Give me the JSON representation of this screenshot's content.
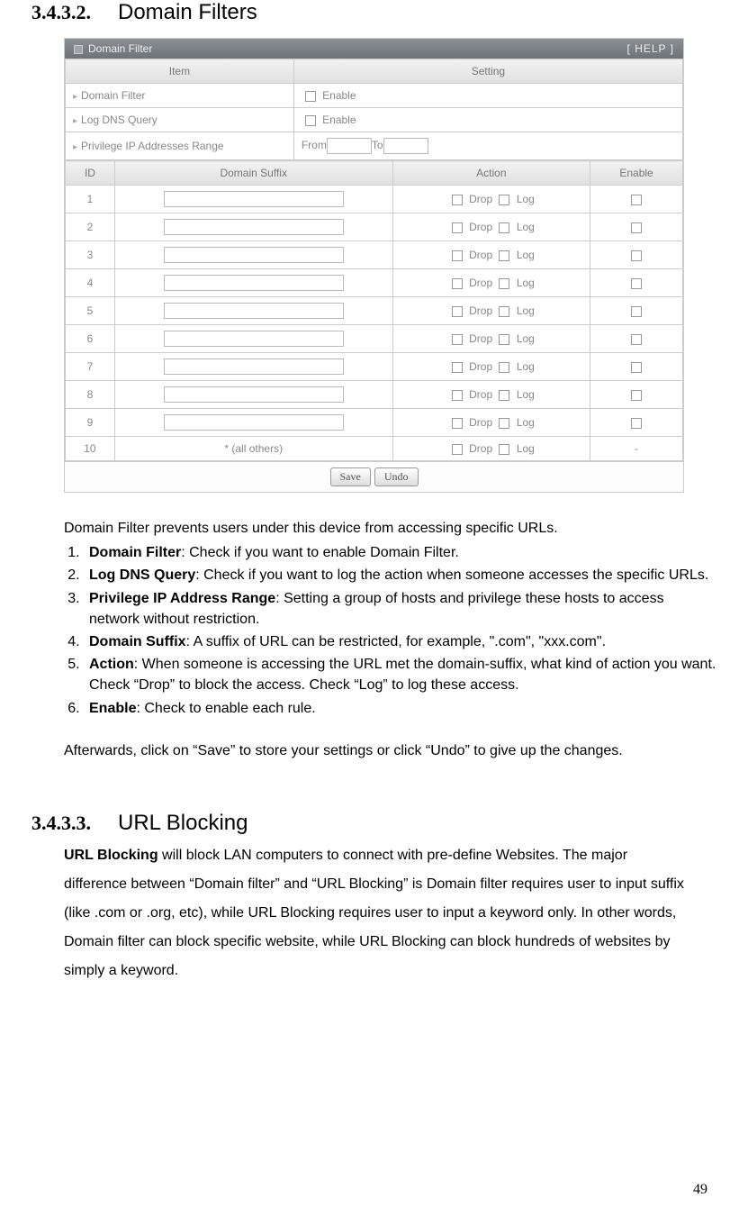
{
  "section1": {
    "num": "3.4.3.2.",
    "title": "Domain Filters"
  },
  "figure": {
    "title_prefix": "Domain Filter",
    "help": "[ HELP ]",
    "head_item": "Item",
    "head_setting": "Setting",
    "row1_label": "Domain Filter",
    "row2_label": "Log DNS Query",
    "row3_label": "Privilege IP Addresses Range",
    "enable_label": "Enable",
    "from": "From",
    "to": "To",
    "col_id": "ID",
    "col_suffix": "Domain Suffix",
    "col_action": "Action",
    "col_enable": "Enable",
    "drop": "Drop",
    "log": "Log",
    "all_others": "* (all others)",
    "save": "Save",
    "undo": "Undo",
    "rows": [
      "1",
      "2",
      "3",
      "4",
      "5",
      "6",
      "7",
      "8",
      "9",
      "10"
    ]
  },
  "body": {
    "intro": "Domain Filter prevents users under this device from accessing specific URLs.",
    "items": {
      "i1_term": "Domain Filter",
      "i1_rest": ": Check if you want to enable Domain Filter.",
      "i2_term": "Log DNS Query",
      "i2_rest": ": Check if you want to log the action when someone accesses the specific URLs.",
      "i3_term": "Privilege IP Address Range",
      "i3_rest": ": Setting a group of hosts and privilege these hosts to access network without restriction.",
      "i4_term": "Domain Suffix",
      "i4_rest": ": A suffix of URL can be restricted, for example, \".com\", \"xxx.com\".",
      "i5_term": "Action",
      "i5_rest": ": When someone is accessing the URL met the domain-suffix, what kind of action you want.",
      "i5_extra": "Check “Drop” to block the access. Check “Log” to log these access.",
      "i6_term": "Enable",
      "i6_rest": ": Check to enable each rule."
    },
    "after": "Afterwards, click on “Save” to store your settings or click “Undo” to give up the changes."
  },
  "section2": {
    "num": "3.4.3.3.",
    "title": "URL Blocking",
    "term": "URL Blocking",
    "para": " will block LAN computers to connect with pre-define Websites. The major difference between “Domain filter” and “URL Blocking” is Domain filter requires user to input suffix (like .com or .org, etc), while URL Blocking requires user to input a keyword only. In other words, Domain filter can block specific website, while URL Blocking can block hundreds of websites by simply a keyword."
  },
  "page": "49"
}
